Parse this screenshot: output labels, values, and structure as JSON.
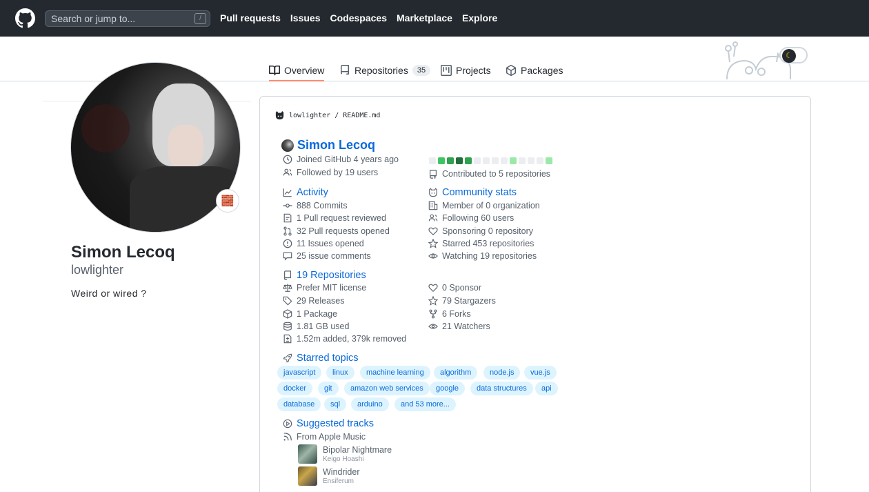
{
  "header": {
    "search_placeholder": "Search or jump to...",
    "search_key": "/",
    "nav": [
      "Pull requests",
      "Issues",
      "Codespaces",
      "Marketplace",
      "Explore"
    ]
  },
  "tabs": {
    "overview": "Overview",
    "repositories": "Repositories",
    "repositories_count": "35",
    "projects": "Projects",
    "packages": "Packages"
  },
  "profile": {
    "name": "Simon Lecoq",
    "login": "lowlighter",
    "bio": "Weird or wired ?",
    "status_emoji": "🧱"
  },
  "readme": {
    "owner": "lowlighter",
    "separator": "/",
    "file": "README.md"
  },
  "metrics": {
    "user": {
      "name": "Simon Lecoq",
      "joined": "Joined GitHub 4 years ago",
      "followed": "Followed by 19 users",
      "contributed": "Contributed to 5 repositories"
    },
    "activity": {
      "title": "Activity",
      "items": [
        "888 Commits",
        "1 Pull request reviewed",
        "32 Pull requests opened",
        "11 Issues opened",
        "25 issue comments"
      ]
    },
    "community": {
      "title": "Community stats",
      "items": [
        "Member of 0 organization",
        "Following 60 users",
        "Sponsoring 0 repository",
        "Starred 453 repositories",
        "Watching 19 repositories"
      ]
    },
    "repositories": {
      "title": "19 Repositories",
      "left": [
        "Prefer MIT license",
        "29 Releases",
        "1 Package",
        "1.81 GB used",
        "1.52m added, 379k removed"
      ],
      "right": [
        "0 Sponsor",
        "79 Stargazers",
        "6 Forks",
        "21 Watchers"
      ]
    },
    "topics": {
      "title": "Starred topics",
      "items": [
        "javascript",
        "linux",
        "machine learning",
        "algorithm",
        "node.js",
        "vue.js",
        "docker",
        "git",
        "amazon web services",
        "google",
        "data structures",
        "api",
        "database",
        "sql",
        "arduino",
        "and 53 more..."
      ]
    },
    "tracks": {
      "title": "Suggested tracks",
      "source": "From Apple Music",
      "items": [
        {
          "title": "Bipolar Nightmare",
          "artist": "Keigo Hoashi"
        },
        {
          "title": "Windrider",
          "artist": "Ensiferum"
        }
      ]
    },
    "calendar_levels": [
      0,
      2,
      3,
      4,
      3,
      0,
      0,
      0,
      0,
      1,
      0,
      0,
      0,
      1
    ]
  },
  "colors": {
    "header_bg": "#24292f",
    "link": "#0969da",
    "tab_underline": "#fd8c73",
    "calendar": [
      "#ebedf0",
      "#9be9a8",
      "#40c463",
      "#30a14e",
      "#216e39"
    ]
  }
}
